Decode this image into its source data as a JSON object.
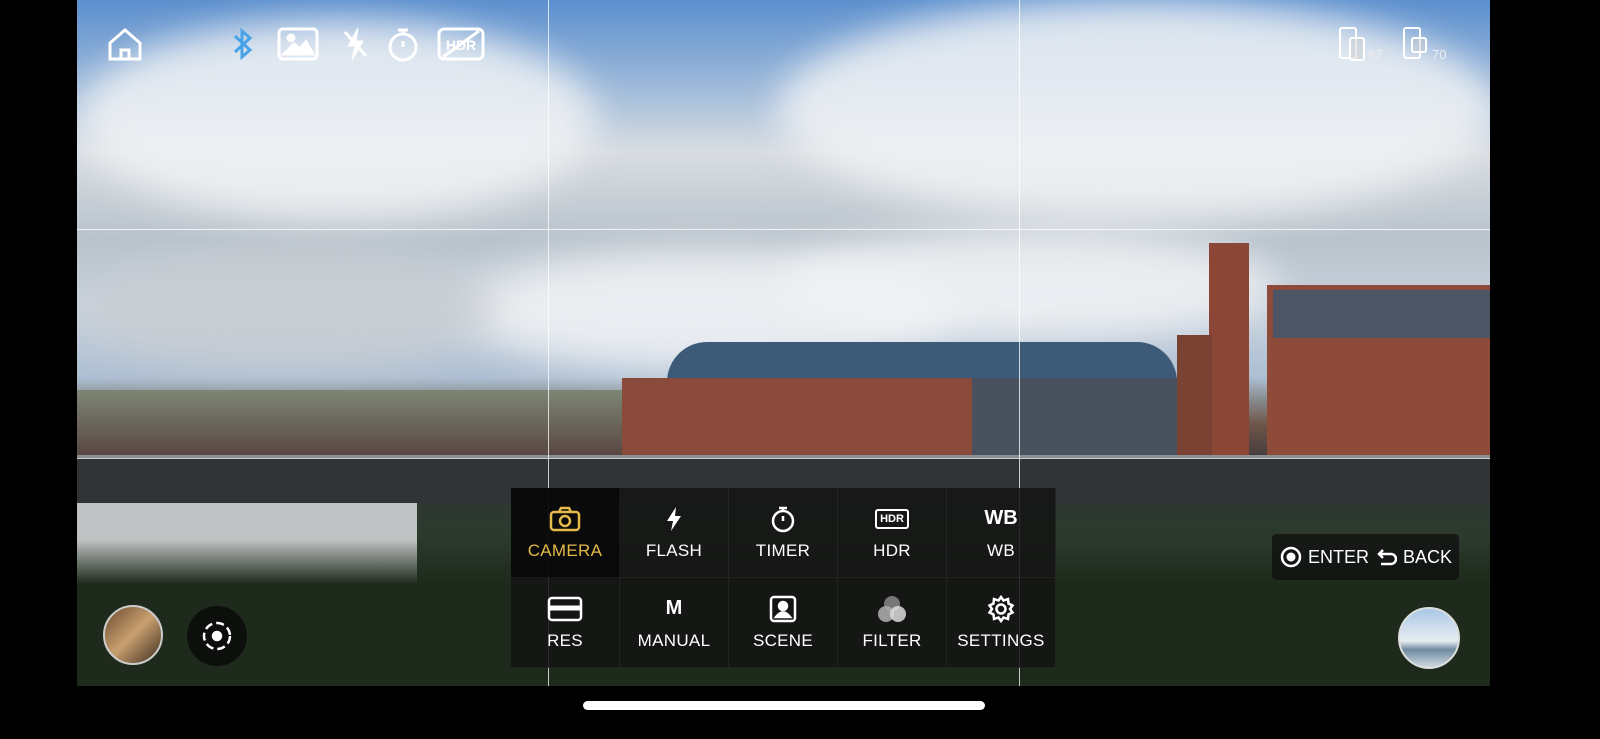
{
  "top_icons": [
    {
      "name": "home-icon"
    },
    {
      "name": "bluetooth-icon",
      "color": "#4aa3e8"
    },
    {
      "name": "gallery-icon"
    },
    {
      "name": "flash-off-icon"
    },
    {
      "name": "timer-icon"
    },
    {
      "name": "hdr-off-icon",
      "text": "HDR"
    }
  ],
  "battery": {
    "camera_level": "67",
    "phone_level": "70"
  },
  "menu": [
    {
      "label": "CAMERA",
      "icon": "camera-icon",
      "active": true
    },
    {
      "label": "FLASH",
      "icon": "flash-icon"
    },
    {
      "label": "TIMER",
      "icon": "timer-icon"
    },
    {
      "label": "HDR",
      "icon": "hdr-icon",
      "icon_text": "HDR"
    },
    {
      "label": "WB",
      "icon": "wb-icon",
      "icon_text": "WB"
    },
    {
      "label": "RES",
      "icon": "resolution-icon"
    },
    {
      "label": "MANUAL",
      "icon": "manual-icon",
      "icon_text": "M"
    },
    {
      "label": "SCENE",
      "icon": "scene-icon"
    },
    {
      "label": "FILTER",
      "icon": "filter-icon"
    },
    {
      "label": "SETTINGS",
      "icon": "settings-icon"
    }
  ],
  "controls": {
    "enter": "ENTER",
    "back": "BACK"
  },
  "accent": "#e6b94b"
}
